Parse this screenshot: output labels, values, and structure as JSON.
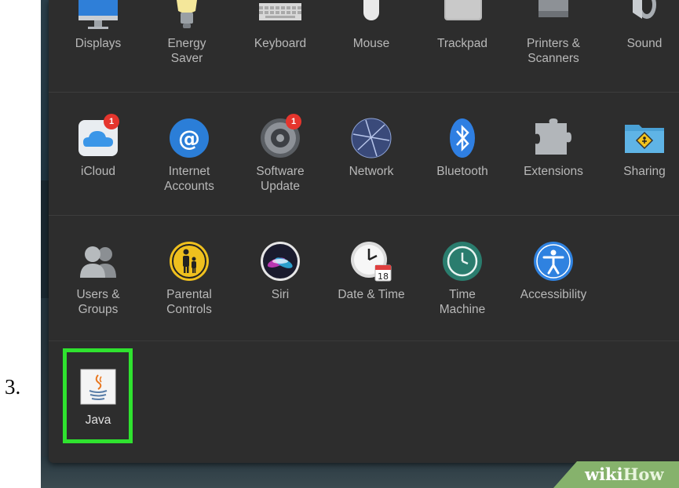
{
  "step": {
    "number": "3."
  },
  "rows": {
    "hardware": [
      {
        "label": "Displays",
        "icon": "display-icon"
      },
      {
        "label": "Energy\nSaver",
        "icon": "bulb-icon"
      },
      {
        "label": "Keyboard",
        "icon": "keyboard-icon"
      },
      {
        "label": "Mouse",
        "icon": "mouse-icon"
      },
      {
        "label": "Trackpad",
        "icon": "trackpad-icon"
      },
      {
        "label": "Printers &\nScanners",
        "icon": "printer-icon"
      },
      {
        "label": "Sound",
        "icon": "speaker-icon"
      }
    ],
    "internet": [
      {
        "label": "iCloud",
        "icon": "icloud-icon",
        "badge": "1"
      },
      {
        "label": "Internet\nAccounts",
        "icon": "at-sign-icon"
      },
      {
        "label": "Software\nUpdate",
        "icon": "gear-icon",
        "badge": "1"
      },
      {
        "label": "Network",
        "icon": "globe-icon"
      },
      {
        "label": "Bluetooth",
        "icon": "bluetooth-icon"
      },
      {
        "label": "Extensions",
        "icon": "puzzle-icon"
      },
      {
        "label": "Sharing",
        "icon": "folder-sign-icon"
      }
    ],
    "system": [
      {
        "label": "Users &\nGroups",
        "icon": "users-icon"
      },
      {
        "label": "Parental\nControls",
        "icon": "parental-icon"
      },
      {
        "label": "Siri",
        "icon": "siri-icon"
      },
      {
        "label": "Date & Time",
        "icon": "clock-calendar-icon",
        "calendar_day": "18"
      },
      {
        "label": "Time\nMachine",
        "icon": "time-machine-icon"
      },
      {
        "label": "Accessibility",
        "icon": "accessibility-icon"
      }
    ],
    "other": [
      {
        "label": "Java",
        "icon": "java-icon"
      }
    ]
  },
  "highlight_color": "#2fe22f",
  "watermark": {
    "part1": "wiki",
    "part2": "How"
  }
}
